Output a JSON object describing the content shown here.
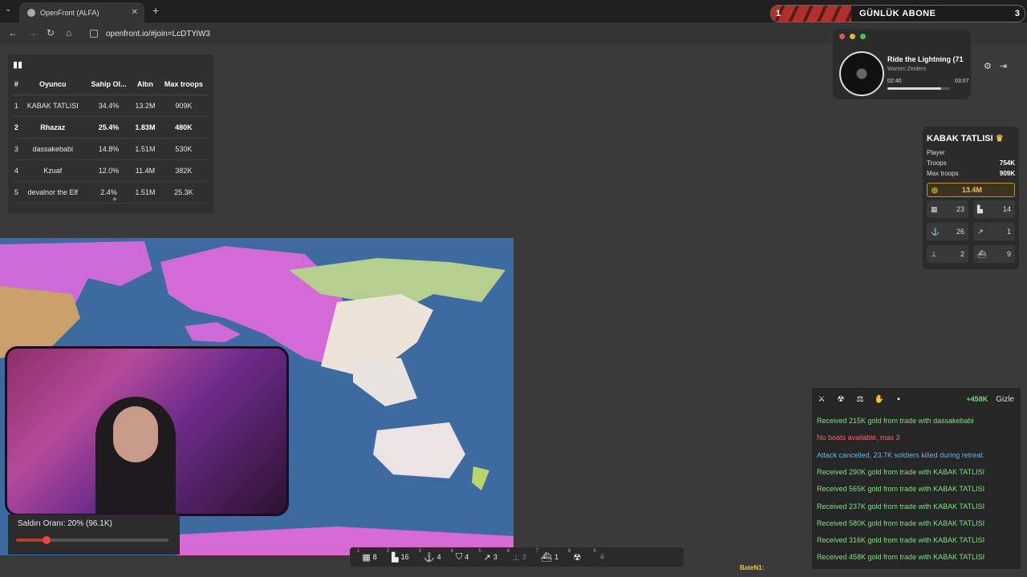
{
  "browser": {
    "tab_title": "OpenFront (ALFA)",
    "url": "openfront.io/#join=LcDTYiW3"
  },
  "banner": {
    "left_number": "1",
    "title": "GÜNLÜK ABONE",
    "right_number": "3"
  },
  "leaderboard": {
    "headers": [
      "#",
      "Oyuncu",
      "Sahip Ol...",
      "Altın",
      "Max troops"
    ],
    "rows": [
      [
        "1",
        "KABAK TATLISI",
        "34.4%",
        "13.2M",
        "909K"
      ],
      [
        "2",
        "Rhazaz",
        "25.4%",
        "1.83M",
        "480K"
      ],
      [
        "3",
        "dassakebabi",
        "14.8%",
        "1.51M",
        "530K"
      ],
      [
        "4",
        "Kzuaf",
        "12.0%",
        "11.4M",
        "382K"
      ],
      [
        "5",
        "devalnor the Elf",
        "2.4%",
        "1.51M",
        "25.3K"
      ]
    ],
    "highlight_row": 1,
    "more_label": "+"
  },
  "music": {
    "song": "Ride the Lightning (71",
    "artist": "Warren Zeiders",
    "elapsed": "02:40",
    "total": "03:07",
    "progress": 0.86
  },
  "player": {
    "name": "KABAK TATLISI",
    "crown": "♛",
    "type": "Player",
    "troops_label": "Troops",
    "troops": "754K",
    "max_troops_label": "Max troops",
    "max_troops": "909K",
    "gold": "13.4M",
    "buildings": [
      {
        "icon": "city-icon",
        "value": "23"
      },
      {
        "icon": "factory-icon",
        "value": "14"
      },
      {
        "icon": "port-icon",
        "value": "26"
      },
      {
        "icon": "missile-silo-icon",
        "value": "1"
      },
      {
        "icon": "sam-launcher-icon",
        "value": "2"
      },
      {
        "icon": "warship-icon",
        "value": "9"
      }
    ]
  },
  "attack": {
    "label": "Saldırı Oranı: 20% (96.1K)",
    "ratio": 0.2
  },
  "events": {
    "gain": "+458K",
    "hide_label": "Gizle",
    "messages": [
      {
        "text": "Received 215K gold from trade with dassakebabi",
        "color": "#7fe07f"
      },
      {
        "text": "No boats available, max 3",
        "color": "#e06b6b"
      },
      {
        "text": "Attack cancelled, 23.7K soldiers killed during retreat.",
        "color": "#5fb5f0"
      },
      {
        "text": "Received 290K gold from trade with KABAK TATLISI",
        "color": "#7fe07f"
      },
      {
        "text": "Received 565K gold from trade with KABAK TATLISI",
        "color": "#7fe07f"
      },
      {
        "text": "Received 237K gold from trade with KABAK TATLISI",
        "color": "#7fe07f"
      },
      {
        "text": "Received 580K gold from trade with KABAK TATLISI",
        "color": "#7fe07f"
      },
      {
        "text": "Received 316K gold from trade with KABAK TATLISI",
        "color": "#7fe07f"
      },
      {
        "text": "Received 458K gold from trade with KABAK TATLISI",
        "color": "#7fe07f"
      }
    ]
  },
  "buildbar": [
    {
      "key": "1",
      "icon": "city-icon",
      "value": "8"
    },
    {
      "key": "2",
      "icon": "factory-icon",
      "value": "16"
    },
    {
      "key": "3",
      "icon": "port-icon",
      "value": "4"
    },
    {
      "key": "4",
      "icon": "defense-post-icon",
      "value": "4"
    },
    {
      "key": "5",
      "icon": "missile-silo-icon",
      "value": "3"
    },
    {
      "key": "6",
      "icon": "sam-launcher-icon",
      "value": "3"
    },
    {
      "key": "7",
      "icon": "warship-icon",
      "value": "1"
    },
    {
      "key": "8",
      "icon": "nuke-icon",
      "value": ""
    },
    {
      "key": "9",
      "icon": "hydrogen-bomb-icon",
      "value": ""
    }
  ],
  "nickname": "BateN1:"
}
